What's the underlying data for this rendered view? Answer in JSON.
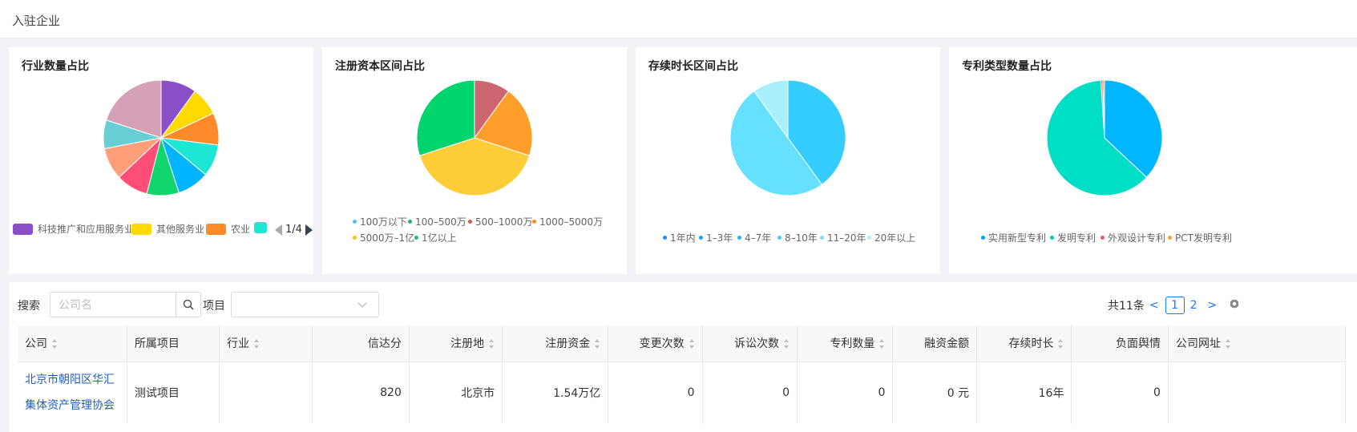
{
  "header": {
    "title": "入驻企业"
  },
  "cards": [
    {
      "title": "行业数量占比",
      "slices": [
        {
          "value": 10,
          "color": "#8a4fc7"
        },
        {
          "value": 8,
          "color": "#ffd900"
        },
        {
          "value": 9,
          "color": "#ff8a2a"
        },
        {
          "value": 9,
          "color": "#1de7d4"
        },
        {
          "value": 9,
          "color": "#00b4ff"
        },
        {
          "value": 9,
          "color": "#11d66d"
        },
        {
          "value": 9,
          "color": "#ff4f78"
        },
        {
          "value": 9,
          "color": "#ff9f7a"
        },
        {
          "value": 8,
          "color": "#67cfd3"
        },
        {
          "value": 20,
          "color": "#d4a1b6"
        }
      ],
      "legend": [
        {
          "label": "科技推广和应用服务业",
          "color": "#8a4fc7"
        },
        {
          "label": "其他服务业",
          "color": "#ffd900"
        },
        {
          "label": "农业",
          "color": "#ff8a2a"
        },
        {
          "label": "",
          "color": "#1de7d4"
        }
      ],
      "pager": "1/4"
    },
    {
      "title": "注册资本区间占比",
      "slices": [
        {
          "value": 10,
          "color": "#cc6670"
        },
        {
          "value": 20,
          "color": "#ff9f2a"
        },
        {
          "value": 40,
          "color": "#ffcd38"
        },
        {
          "value": 30,
          "color": "#00d46f"
        }
      ],
      "legend": [
        {
          "label": "100万以下",
          "color": "#4fc3f7"
        },
        {
          "label": "100–500万",
          "color": "#23b26d"
        },
        {
          "label": "500–1000万",
          "color": "#d9534f"
        },
        {
          "label": "1000–5000万",
          "color": "#ff8c1a"
        },
        {
          "label": "5000万–1亿",
          "color": "#f5c518"
        },
        {
          "label": "1亿以上",
          "color": "#19c26b"
        }
      ]
    },
    {
      "title": "存续时长区间占比",
      "slices": [
        {
          "value": 40,
          "color": "#35ccff"
        },
        {
          "value": 50,
          "color": "#66e0ff"
        },
        {
          "value": 10,
          "color": "#a8f0fc"
        }
      ],
      "legend": [
        {
          "label": "1年内",
          "color": "#1890ff"
        },
        {
          "label": "1–3年",
          "color": "#1aa1e6"
        },
        {
          "label": "4–7年",
          "color": "#2bb3f0"
        },
        {
          "label": "8–10年",
          "color": "#4ccbef"
        },
        {
          "label": "11–20年",
          "color": "#7fdcf5"
        },
        {
          "label": "20年以上",
          "color": "#b5ebf9"
        }
      ]
    },
    {
      "title": "专利类型数量占比",
      "slices": [
        {
          "value": 37,
          "color": "#00b6ff"
        },
        {
          "value": 62,
          "color": "#00dfc6"
        },
        {
          "value": 0.5,
          "color": "#ff4f6a"
        },
        {
          "value": 0.5,
          "color": "#ff9f2a"
        }
      ],
      "legend": [
        {
          "label": "实用新型专利",
          "color": "#00a2e8"
        },
        {
          "label": "发明专利",
          "color": "#00c9b1"
        },
        {
          "label": "外观设计专利",
          "color": "#ff4f6a"
        },
        {
          "label": "PCT发明专利",
          "color": "#ff9f2a"
        }
      ]
    }
  ],
  "filters": {
    "search_label": "搜索",
    "search_placeholder": "公司名",
    "project_label": "项目",
    "total": "共11条",
    "page1": "1",
    "page2": "2"
  },
  "table": {
    "headers": [
      "公司",
      "所属项目",
      "行业",
      "信达分",
      "注册地",
      "注册资金",
      "变更次数",
      "诉讼次数",
      "专利数量",
      "融资金额",
      "存续时长",
      "负面舆情",
      "公司网址"
    ],
    "row": {
      "company": "北京市朝阳区华汇集体资产管理协会",
      "project": "测试项目",
      "industry": "",
      "score": "820",
      "location": "北京市",
      "capital": "1.54万亿",
      "changes": "0",
      "lawsuits": "0",
      "patents": "0",
      "financing": "0 元",
      "duration": "16年",
      "negative": "0",
      "website": ""
    }
  }
}
